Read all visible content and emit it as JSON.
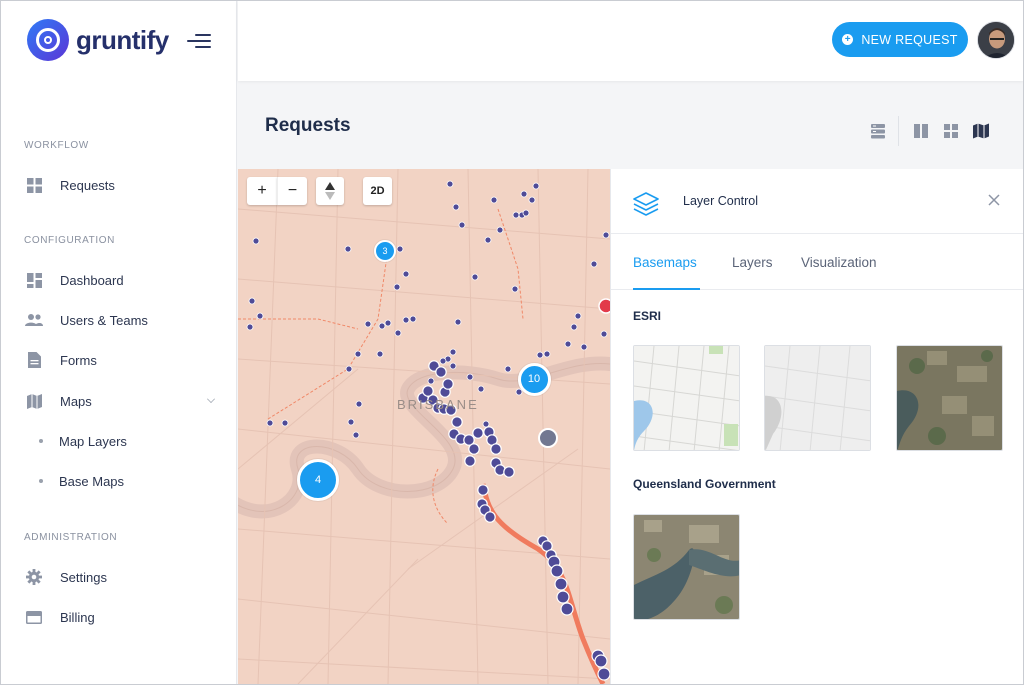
{
  "app": {
    "name": "gruntify"
  },
  "sidebar": {
    "sections": [
      {
        "label": "WORKFLOW"
      },
      {
        "label": "CONFIGURATION"
      },
      {
        "label": "ADMINISTRATION"
      }
    ],
    "items": {
      "requests": {
        "label": "Requests",
        "icon": "grid-icon"
      },
      "dashboard": {
        "label": "Dashboard",
        "icon": "dashboard-icon"
      },
      "users_teams": {
        "label": "Users & Teams",
        "icon": "people-icon"
      },
      "forms": {
        "label": "Forms",
        "icon": "document-icon"
      },
      "maps": {
        "label": "Maps",
        "icon": "map-icon",
        "expanded": true
      },
      "map_layers": {
        "label": "Map Layers"
      },
      "base_maps": {
        "label": "Base Maps"
      },
      "settings": {
        "label": "Settings",
        "icon": "gear-icon"
      },
      "billing": {
        "label": "Billing",
        "icon": "card-icon"
      }
    }
  },
  "topbar": {
    "new_request_label": "NEW REQUEST",
    "accent": "#1a9cf0"
  },
  "page": {
    "title": "Requests",
    "view_icons": [
      "list-view-icon",
      "split-view-icon",
      "grid-view-icon",
      "map-view-icon"
    ],
    "active_view": "map-view-icon"
  },
  "map": {
    "zoom_in": "+",
    "zoom_out": "−",
    "mode_label": "2D",
    "place_label": "BRISBANE",
    "clusters": [
      {
        "count": "3"
      },
      {
        "count": "10"
      },
      {
        "count": "4"
      }
    ],
    "marker_color": "#4f4b97",
    "cluster_color": "#1a9cf0"
  },
  "layer_control": {
    "title": "Layer Control",
    "tabs": [
      "Basemaps",
      "Layers",
      "Visualization"
    ],
    "active_tab": "Basemaps",
    "groups": [
      {
        "label": "ESRI",
        "thumbnails": [
          "streets",
          "light-gray",
          "imagery"
        ]
      },
      {
        "label": "Queensland Government",
        "thumbnails": [
          "aerial"
        ]
      }
    ]
  }
}
